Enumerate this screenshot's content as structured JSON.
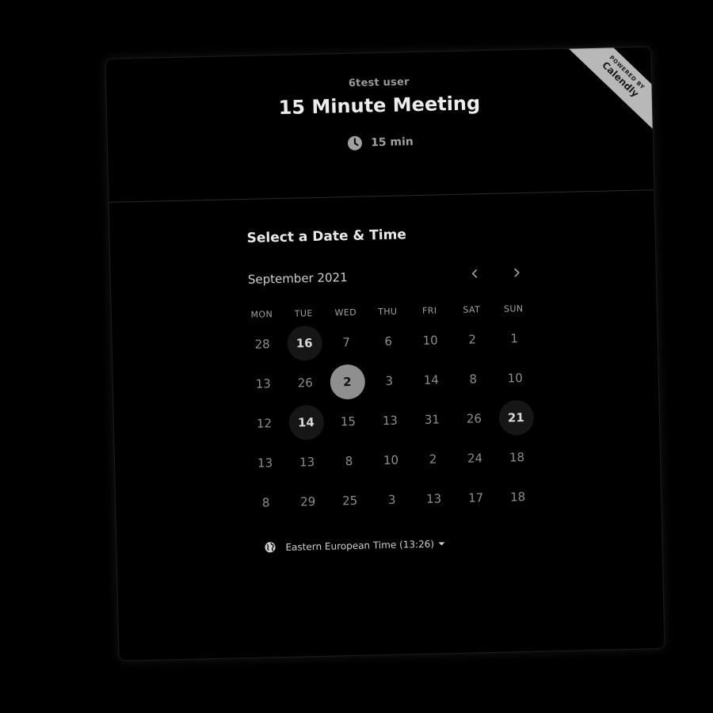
{
  "event": {
    "host": "6test user",
    "title": "15 Minute Meeting",
    "duration": "15 min"
  },
  "badge": {
    "powered_by": "POWERED BY",
    "brand": "Calendly"
  },
  "calendar": {
    "section_title": "Select a Date & Time",
    "month_label": "September 2021",
    "weekdays": [
      "MON",
      "TUE",
      "WED",
      "THU",
      "FRI",
      "SAT",
      "SUN"
    ],
    "days": [
      {
        "label": "28",
        "state": "unavailable"
      },
      {
        "label": "16",
        "state": "available"
      },
      {
        "label": "7",
        "state": "unavailable"
      },
      {
        "label": "6",
        "state": "unavailable"
      },
      {
        "label": "10",
        "state": "unavailable"
      },
      {
        "label": "2",
        "state": "unavailable"
      },
      {
        "label": "1",
        "state": "unavailable"
      },
      {
        "label": "13",
        "state": "unavailable"
      },
      {
        "label": "26",
        "state": "unavailable"
      },
      {
        "label": "2",
        "state": "selected"
      },
      {
        "label": "3",
        "state": "unavailable"
      },
      {
        "label": "14",
        "state": "unavailable"
      },
      {
        "label": "8",
        "state": "unavailable"
      },
      {
        "label": "10",
        "state": "unavailable"
      },
      {
        "label": "12",
        "state": "unavailable"
      },
      {
        "label": "14",
        "state": "available"
      },
      {
        "label": "15",
        "state": "unavailable"
      },
      {
        "label": "13",
        "state": "unavailable"
      },
      {
        "label": "31",
        "state": "unavailable"
      },
      {
        "label": "26",
        "state": "unavailable"
      },
      {
        "label": "21",
        "state": "available"
      },
      {
        "label": "13",
        "state": "unavailable"
      },
      {
        "label": "13",
        "state": "unavailable"
      },
      {
        "label": "8",
        "state": "unavailable"
      },
      {
        "label": "10",
        "state": "unavailable"
      },
      {
        "label": "2",
        "state": "unavailable"
      },
      {
        "label": "24",
        "state": "unavailable"
      },
      {
        "label": "18",
        "state": "unavailable"
      },
      {
        "label": "8",
        "state": "unavailable"
      },
      {
        "label": "29",
        "state": "unavailable"
      },
      {
        "label": "25",
        "state": "unavailable"
      },
      {
        "label": "3",
        "state": "unavailable"
      },
      {
        "label": "13",
        "state": "unavailable"
      },
      {
        "label": "17",
        "state": "unavailable"
      },
      {
        "label": "18",
        "state": "unavailable"
      }
    ]
  },
  "timezone": {
    "label": "Eastern European Time (13:26)"
  },
  "colors": {
    "background": "#000000",
    "selected_day": "#8f8f8f",
    "available_day": "#161616",
    "ribbon": "#b8b8b8"
  }
}
